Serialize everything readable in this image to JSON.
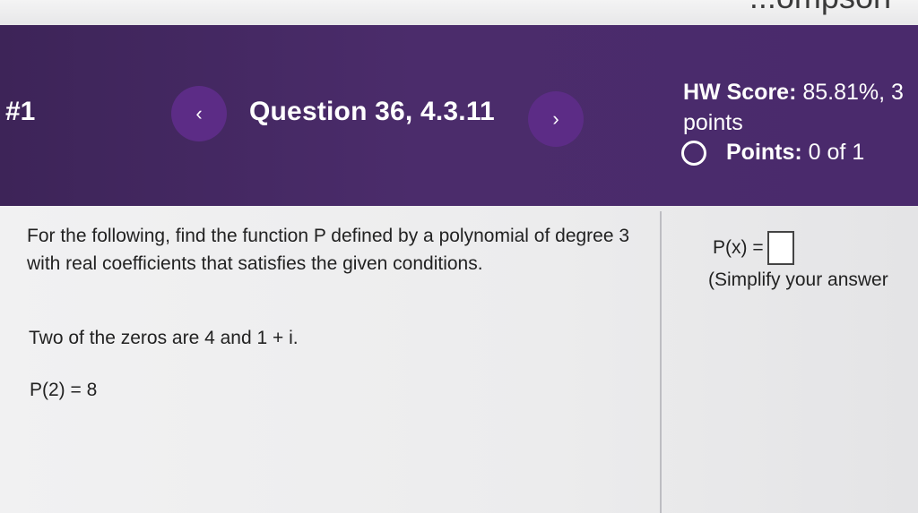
{
  "top_strip": {
    "partial_text": "...ompson"
  },
  "header": {
    "item_number": "#1",
    "prev_label": "‹",
    "question_title": "Question 36, 4.3.11",
    "next_label": "›",
    "hw_score_label": "HW Score:",
    "hw_score_value": "85.81%, 3",
    "hw_score_unit": "points",
    "points_label": "Points:",
    "points_value": "0 of 1"
  },
  "question": {
    "prompt": "For the following, find the function P defined by a polynomial of degree 3 with real coefficients that satisfies the given conditions.",
    "zeros": "Two of the zeros are 4 and 1 + i.",
    "condition": "P(2) = 8"
  },
  "answer": {
    "label": "P(x) =",
    "input_value": "",
    "hint": "(Simplify your answer"
  },
  "colors": {
    "header_bg": "#4a2a6c",
    "nav_button": "#5c2c86",
    "content_bg": "#eeeeef"
  }
}
